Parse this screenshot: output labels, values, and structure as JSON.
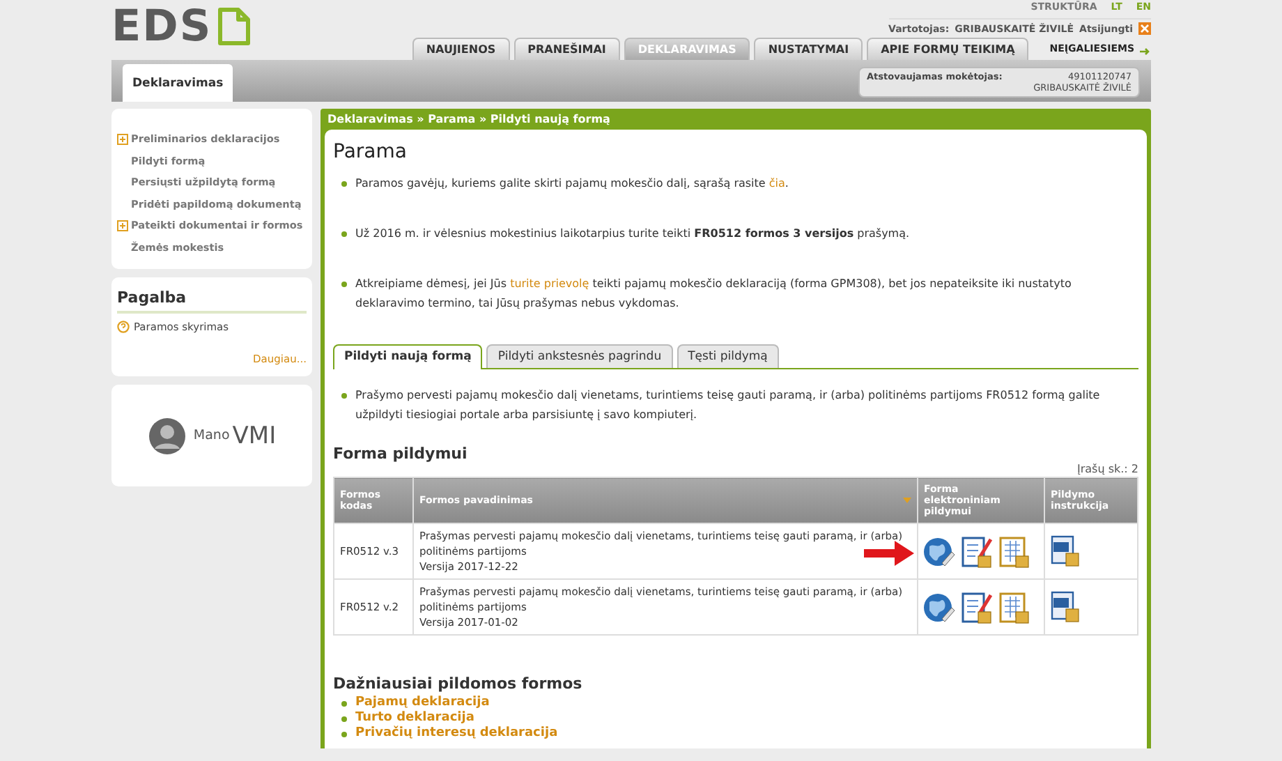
{
  "header": {
    "logo": "EDS",
    "top_links": [
      "STRUKTŪRA",
      "LT",
      "EN"
    ],
    "user_label": "Vartotojas:",
    "user_name": "GRIBAUSKAITĖ ŽIVILĖ",
    "logout": "Atsijungti"
  },
  "nav": {
    "tabs": [
      {
        "label": "NAUJIENOS",
        "selected": false
      },
      {
        "label": "PRANEŠIMAI",
        "selected": false
      },
      {
        "label": "DEKLARAVIMAS",
        "selected": true
      },
      {
        "label": "NUSTATYMAI",
        "selected": false
      },
      {
        "label": "APIE FORMŲ TEIKIMĄ",
        "selected": false
      }
    ],
    "extra": "NEĮGALIESIEMS"
  },
  "subbar": {
    "tab": "Deklaravimas",
    "rep_label": "Atstovaujamas mokėtojas:",
    "rep_code": "49101120747",
    "rep_name": "GRIBAUSKAITĖ ŽIVILĖ"
  },
  "sidebar": {
    "items": [
      {
        "label": "Preliminarios deklaracijos",
        "expandable": true
      },
      {
        "label": "Pildyti formą",
        "expandable": false
      },
      {
        "label": "Persiųsti užpildytą formą",
        "expandable": false
      },
      {
        "label": "Pridėti papildomą dokumentą",
        "expandable": false
      },
      {
        "label": "Pateikti dokumentai ir formos",
        "expandable": true
      },
      {
        "label": "Žemės mokestis",
        "expandable": false
      }
    ],
    "help_title": "Pagalba",
    "help_items": [
      "Paramos skyrimas"
    ],
    "help_more": "Daugiau...",
    "banner": {
      "mano": "Mano",
      "vmi": "VMI"
    }
  },
  "breadcrumb": "Deklaravimas » Parama » Pildyti naują formą",
  "page_title": "Parama",
  "notes": [
    {
      "text": "Paramos gavėjų, kuriems galite skirti pajamų mokesčio dalį, sąrašą rasite ",
      "link": "čia",
      "after": "."
    },
    {
      "text": "Už 2016 m. ir vėlesnius mokestinius laikotarpius turite teikti **FR0512 formos 3 versijos** prašymą."
    },
    {
      "text": "Atkreipiame dėmesį, jei Jūs ",
      "link": "turite prievolę",
      "after": " teikti pajamų mokesčio deklaraciją (forma GPM308), bet jos nepateiksite iki nustatyto deklaravimo termino, tai Jūsų prašymas nebus vykdomas."
    }
  ],
  "tabs": [
    {
      "label": "Pildyti naują formą",
      "selected": true
    },
    {
      "label": "Pildyti ankstesnės pagrindu",
      "selected": false
    },
    {
      "label": "Tęsti pildymą",
      "selected": false
    }
  ],
  "tab_note": "Prašymo pervesti pajamų mokesčio dalį vienetams, turintiems teisę gauti paramą, ir (arba) politinėms partijoms FR0512 formą galite užpildyti tiesiogiai portale arba parsisiuntę į savo kompiuterį.",
  "forms_title": "Forma pildymui",
  "count": "Įrašų sk.: 2",
  "table": {
    "columns": [
      "Formos kodas",
      "Formos pavadinimas",
      "Forma elektroniniam pildymui",
      "Pildymo instrukcija"
    ],
    "rows": [
      {
        "code": "FR0512 v.3",
        "name": "Prašymas pervesti pajamų mokesčio dalį vienetams, turintiems teisę gauti paramą, ir (arba) politinėms partijoms",
        "version": "Versija 2017-12-22",
        "highlighted": true
      },
      {
        "code": "FR0512 v.2",
        "name": "Prašymas pervesti pajamų mokesčio dalį vienetams, turintiems teisę gauti paramą, ir (arba) politinėms partijoms",
        "version": "Versija 2017-01-02",
        "highlighted": false
      }
    ]
  },
  "popular_title": "Dažniausiai pildomos formos",
  "popular": [
    "Pajamų deklaracija",
    "Turto deklaracija",
    "Privačių interesų deklaracija"
  ]
}
